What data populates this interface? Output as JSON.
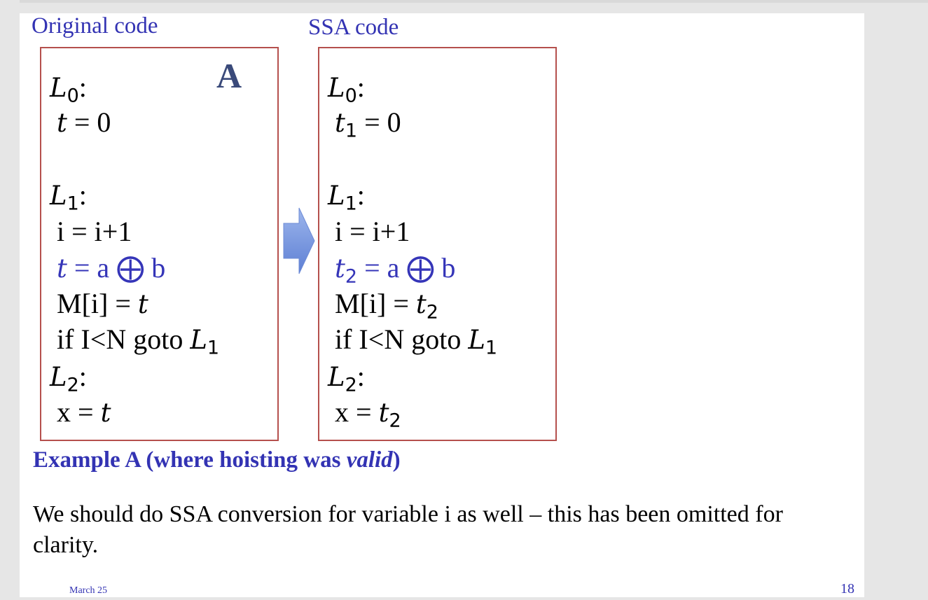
{
  "headings": {
    "original": "Original code",
    "ssa": "SSA code"
  },
  "box_letter": "A",
  "original": {
    "l0": "L",
    "l0_sub": "0",
    "l0_colon": ":",
    "t_init_var": "t",
    "t_init_rest": " = 0",
    "l1": "L",
    "l1_sub": "1",
    "l1_colon": ":",
    "inc": "i = i+1",
    "assign_var": "t",
    "assign_rest": " = a ⨁ b",
    "store_pre": "M[i] = ",
    "store_var": "t",
    "branch_pre": "if I<N goto ",
    "branch_var": "L",
    "branch_sub": "1",
    "l2": "L",
    "l2_sub": "2",
    "l2_colon": ":",
    "final_pre": "x = ",
    "final_var": "t"
  },
  "ssa": {
    "l0": "L",
    "l0_sub": "0",
    "l0_colon": ":",
    "t_init_var": "t",
    "t_init_sub": "1",
    "t_init_rest": " = 0",
    "l1": "L",
    "l1_sub": "1",
    "l1_colon": ":",
    "inc": "i = i+1",
    "assign_var": "t",
    "assign_sub": "2",
    "assign_rest": " = a ⨁ b",
    "store_pre": "M[i] = ",
    "store_var": "t",
    "store_sub": "2",
    "branch_pre": "if I<N goto ",
    "branch_var": "L",
    "branch_sub": "1",
    "l2": "L",
    "l2_sub": "2",
    "l2_colon": ":",
    "final_pre": "x = ",
    "final_var": "t",
    "final_sub": "2"
  },
  "caption": {
    "pre": "Example A (where hoisting was ",
    "em": "valid",
    "post": ")"
  },
  "body_text": "We should do SSA conversion for variable i as well – this has been omitted for clarity.",
  "footer": {
    "date": "March 25",
    "page": "18"
  },
  "colors": {
    "heading": "#3333b3",
    "box_border": "#b5504d",
    "arrow": "#7b9ee0"
  }
}
